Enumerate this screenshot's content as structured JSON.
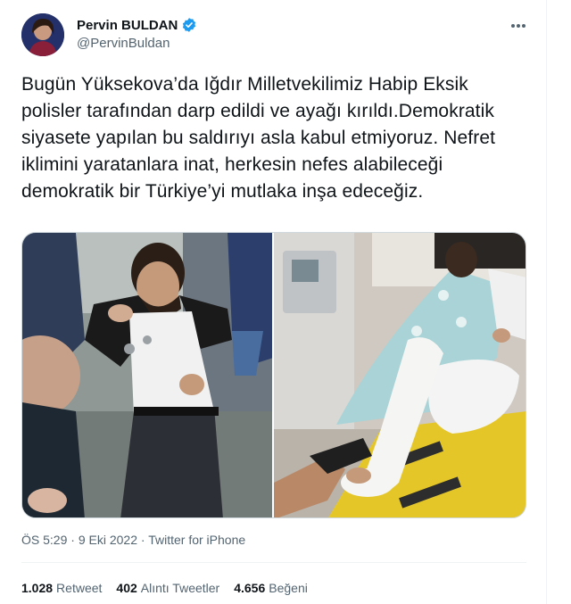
{
  "author": {
    "name": "Pervin BULDAN",
    "handle": "@PervinBuldan",
    "verified": true
  },
  "tweet": {
    "text": "Bugün Yüksekova’da Iğdır Milletvekilimiz Habip Eksik polisler tarafından darp edildi ve ayağı kırıldı.Demokratik siyasete yapılan bu saldırıyı asla kabul etmiyoruz. Nefret iklimini yaratanlara inat, herkesin nefes alabileceği demokratik bir Türkiye’yi mutlaka inşa edeceğiz."
  },
  "meta": {
    "time": "ÖS 5:29",
    "separator1": " · ",
    "date": "9 Eki 2022",
    "separator2": " · ",
    "source": "Twitter for iPhone"
  },
  "stats": {
    "retweets_count": "1.028",
    "retweets_label": "Retweet",
    "quotes_count": "402",
    "quotes_label": "Alıntı Tweetler",
    "likes_count": "4.656",
    "likes_label": "Beğeni"
  },
  "colors": {
    "text": "#0f1419",
    "secondary": "#536471",
    "verified": "#1d9bf0",
    "divider": "#eff3f4"
  },
  "icons": {
    "verified": "verified-badge-icon",
    "more": "more-options-icon"
  }
}
